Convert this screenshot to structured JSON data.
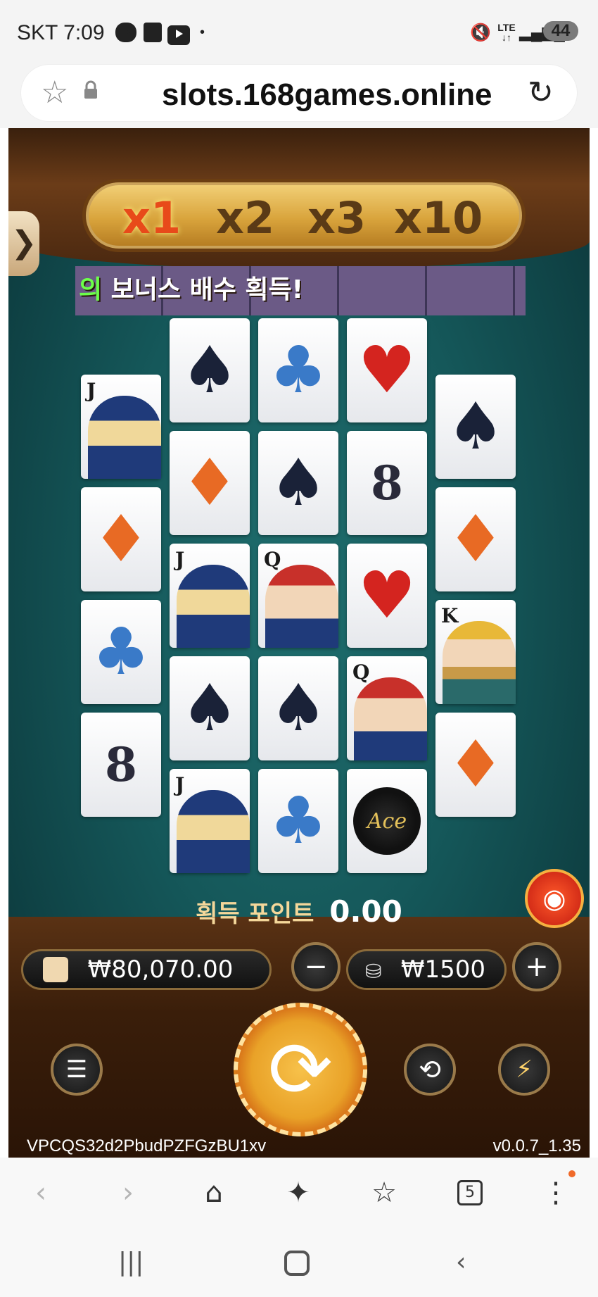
{
  "status_bar": {
    "carrier_time": "SKT 7:09",
    "icons": [
      "chat-icon",
      "b-app-icon",
      "youtube-icon",
      "dot-icon",
      "mute-icon",
      "lte-icon",
      "signal-icon"
    ],
    "battery": "44"
  },
  "browser": {
    "url": "slots.168games.online"
  },
  "game": {
    "multipliers": [
      "x1",
      "x2",
      "x3",
      "x10"
    ],
    "active_multiplier": "x1",
    "side_tab": "❯",
    "bonus_prefix": "의",
    "bonus_text": "보너스 배수 획득!",
    "grid": [
      [
        {
          "rank": "J",
          "suit": "face-jack"
        },
        {
          "rank": "",
          "suit": "diamond"
        },
        {
          "rank": "",
          "suit": "club"
        },
        {
          "rank": "8",
          "suit": "number"
        }
      ],
      [
        {
          "rank": "",
          "suit": "spade"
        },
        {
          "rank": "",
          "suit": "diamond"
        },
        {
          "rank": "J",
          "suit": "face-jack"
        },
        {
          "rank": "",
          "suit": "spade"
        },
        {
          "rank": "J",
          "suit": "face-jack"
        }
      ],
      [
        {
          "rank": "",
          "suit": "club"
        },
        {
          "rank": "",
          "suit": "spade"
        },
        {
          "rank": "Q",
          "suit": "face-queen"
        },
        {
          "rank": "",
          "suit": "spade"
        },
        {
          "rank": "",
          "suit": "club"
        }
      ],
      [
        {
          "rank": "",
          "suit": "heart"
        },
        {
          "rank": "8",
          "suit": "number"
        },
        {
          "rank": "",
          "suit": "heart"
        },
        {
          "rank": "Q",
          "suit": "face-queen"
        },
        {
          "rank": "Ace",
          "suit": "ace-spade"
        }
      ],
      [
        {
          "rank": "",
          "suit": "spade"
        },
        {
          "rank": "",
          "suit": "diamond"
        },
        {
          "rank": "K",
          "suit": "face-king"
        },
        {
          "rank": "",
          "suit": "diamond"
        }
      ]
    ],
    "points_label": "획득 포인트",
    "points_value": "0.00",
    "balance": "₩80,070.00",
    "bet": "₩1500",
    "minus": "−",
    "plus": "+",
    "session_id": "VPCQS32d2PbudPZFGzBU1xv",
    "version": "v0.0.7_1.35"
  },
  "toolbar": {
    "tabs_count": "5"
  }
}
